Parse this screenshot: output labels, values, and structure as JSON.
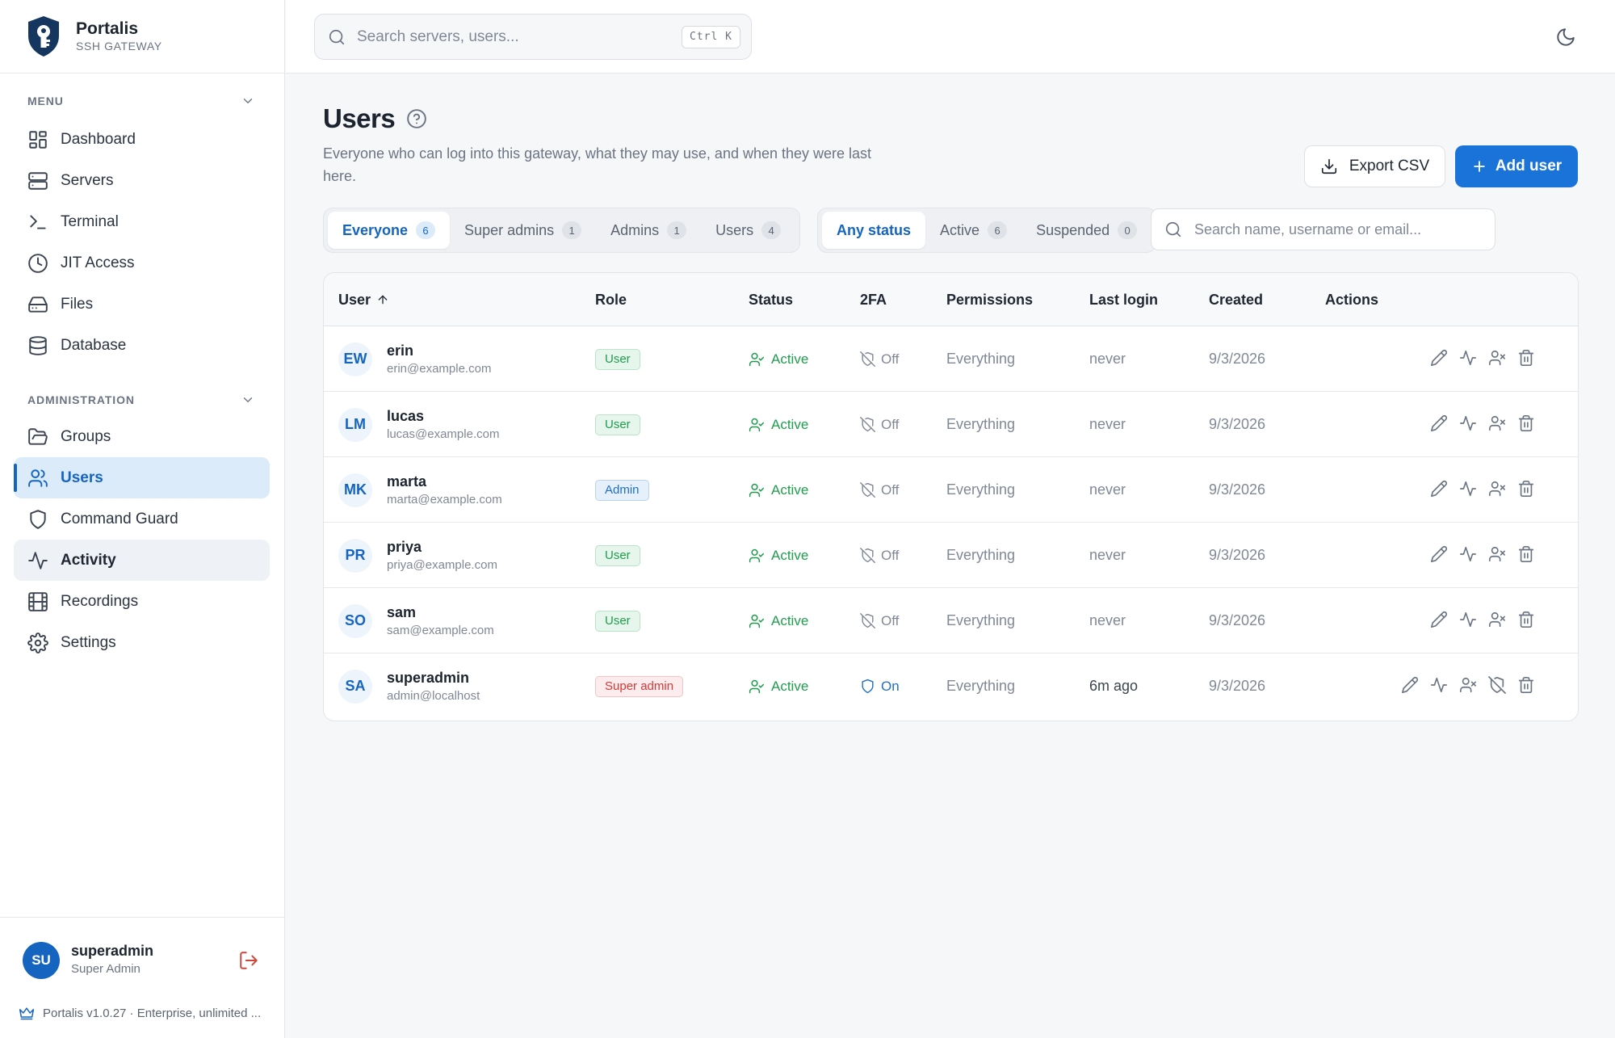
{
  "brand": {
    "name": "Portalis",
    "subtitle": "SSH GATEWAY"
  },
  "sidebar": {
    "menu_label": "MENU",
    "admin_label": "ADMINISTRATION",
    "menu_items": [
      {
        "label": "Dashboard",
        "icon": "dashboard-icon"
      },
      {
        "label": "Servers",
        "icon": "server-icon"
      },
      {
        "label": "Terminal",
        "icon": "terminal-icon"
      },
      {
        "label": "JIT Access",
        "icon": "clock-icon"
      },
      {
        "label": "Files",
        "icon": "hard-drive-icon"
      },
      {
        "label": "Database",
        "icon": "database-icon"
      }
    ],
    "admin_items": [
      {
        "label": "Groups",
        "icon": "folder-icon"
      },
      {
        "label": "Users",
        "icon": "users-icon",
        "active": true
      },
      {
        "label": "Command Guard",
        "icon": "shield-icon"
      },
      {
        "label": "Activity",
        "icon": "activity-icon",
        "hovered": true
      },
      {
        "label": "Recordings",
        "icon": "film-icon"
      },
      {
        "label": "Settings",
        "icon": "gear-icon"
      }
    ],
    "current_user": {
      "initials": "SU",
      "name": "superadmin",
      "role": "Super Admin"
    },
    "version": "Portalis v1.0.27 · Enterprise, unlimited ..."
  },
  "topbar": {
    "search_placeholder": "Search servers, users...",
    "shortcut": "Ctrl K"
  },
  "page": {
    "title": "Users",
    "subtitle": "Everyone who can log into this gateway, what they may use, and when they were last here.",
    "export_label": "Export CSV",
    "add_label": "Add user"
  },
  "role_tabs": [
    {
      "label": "Everyone",
      "count": "6",
      "selected": true
    },
    {
      "label": "Super admins",
      "count": "1"
    },
    {
      "label": "Admins",
      "count": "1"
    },
    {
      "label": "Users",
      "count": "4"
    }
  ],
  "status_tabs": [
    {
      "label": "Any status",
      "selected": true
    },
    {
      "label": "Active",
      "count": "6"
    },
    {
      "label": "Suspended",
      "count": "0"
    }
  ],
  "table_search_placeholder": "Search name, username or email...",
  "table": {
    "columns": [
      "User",
      "Role",
      "Status",
      "2FA",
      "Permissions",
      "Last login",
      "Created",
      "Actions"
    ],
    "sort_column": "User",
    "sort_direction": "ascending",
    "rows": [
      {
        "initials": "EW",
        "username": "erin",
        "email": "erin@example.com",
        "role": "User",
        "role_kind": "user",
        "status": "Active",
        "tfa": "Off",
        "permissions": "Everything",
        "last_login": "never",
        "created": "9/3/2026"
      },
      {
        "initials": "LM",
        "username": "lucas",
        "email": "lucas@example.com",
        "role": "User",
        "role_kind": "user",
        "status": "Active",
        "tfa": "Off",
        "permissions": "Everything",
        "last_login": "never",
        "created": "9/3/2026"
      },
      {
        "initials": "MK",
        "username": "marta",
        "email": "marta@example.com",
        "role": "Admin",
        "role_kind": "admin",
        "status": "Active",
        "tfa": "Off",
        "permissions": "Everything",
        "last_login": "never",
        "created": "9/3/2026"
      },
      {
        "initials": "PR",
        "username": "priya",
        "email": "priya@example.com",
        "role": "User",
        "role_kind": "user",
        "status": "Active",
        "tfa": "Off",
        "permissions": "Everything",
        "last_login": "never",
        "created": "9/3/2026"
      },
      {
        "initials": "SO",
        "username": "sam",
        "email": "sam@example.com",
        "role": "User",
        "role_kind": "user",
        "status": "Active",
        "tfa": "Off",
        "permissions": "Everything",
        "last_login": "never",
        "created": "9/3/2026"
      },
      {
        "initials": "SA",
        "username": "superadmin",
        "email": "admin@localhost",
        "role": "Super admin",
        "role_kind": "super",
        "status": "Active",
        "tfa": "On",
        "permissions": "Everything",
        "last_login": "6m ago",
        "created": "9/3/2026"
      }
    ]
  },
  "colors": {
    "accent": "#1a73d9",
    "active_nav_bg": "#dcebf9",
    "success": "#1f9d4d",
    "danger": "#d33a3a"
  }
}
